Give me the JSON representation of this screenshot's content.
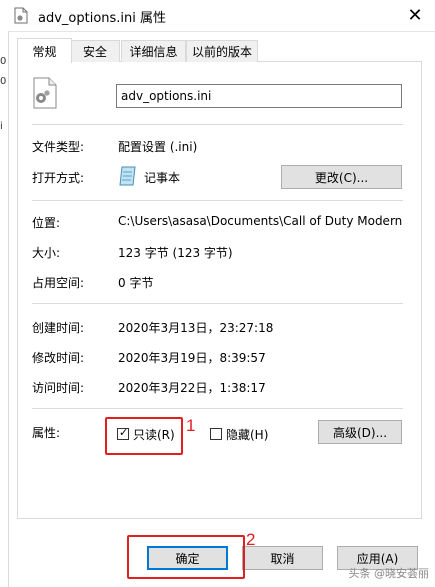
{
  "window": {
    "title": "adv_options.ini 属性",
    "close_symbol": "✕"
  },
  "background_fragment": [
    "0",
    "0",
    "i"
  ],
  "tabs": [
    {
      "label": "常规",
      "active": true
    },
    {
      "label": "安全",
      "active": false
    },
    {
      "label": "详细信息",
      "active": false
    },
    {
      "label": "以前的版本",
      "active": false
    }
  ],
  "general": {
    "file_name": "adv_options.ini",
    "type_label": "文件类型:",
    "type_value": "配置设置 (.ini)",
    "open_with_label": "打开方式:",
    "open_with_value": "记事本",
    "change_button": "更改(C)...",
    "location_label": "位置:",
    "location_value": "C:\\Users\\asasa\\Documents\\Call of Duty Modern Warfa",
    "size_label": "大小:",
    "size_value": "123 字节 (123 字节)",
    "disk_label": "占用空间:",
    "disk_value": "0 字节",
    "created_label": "创建时间:",
    "created_value": "2020年3月13日，23:27:18",
    "modified_label": "修改时间:",
    "modified_value": "2020年3月19日，8:39:57",
    "accessed_label": "访问时间:",
    "accessed_value": "2020年3月22日，1:38:17",
    "attributes_label": "属性:",
    "readonly_label": "只读(R)",
    "readonly_checked": true,
    "hidden_label": "隐藏(H)",
    "hidden_checked": false,
    "advanced_button": "高级(D)..."
  },
  "annotations": {
    "mark1": "1",
    "mark2": "2",
    "color": "#e02020"
  },
  "footer": {
    "ok_button": "确定",
    "cancel_button": "取消",
    "apply_button": "应用(A)"
  },
  "watermark": "头条 @晓安荟丽"
}
